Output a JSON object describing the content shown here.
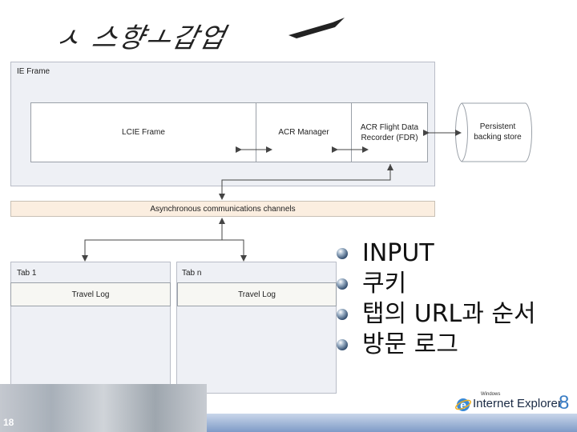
{
  "title": {
    "text": "ㅅ 스향ㅗ갑업"
  },
  "diagram": {
    "ie_frame": "IE Frame",
    "lcie_frame": "LCIE Frame",
    "acr_manager": "ACR Manager",
    "fdr_line1": "ACR Flight Data",
    "fdr_line2": "Recorder (FDR)",
    "persistent_line1": "Persistent",
    "persistent_line2": "backing store",
    "async_channels": "Asynchronous communications channels",
    "tab1": "Tab 1",
    "tabn": "Tab n",
    "travel_log_1": "Travel Log",
    "travel_log_n": "Travel Log"
  },
  "bullets": [
    "INPUT",
    "쿠키",
    "탭의 URL과 순서",
    "방문 로그"
  ],
  "footer": {
    "page_number": "18",
    "logo_small": "Windows",
    "logo_text": "Internet Explorer",
    "logo_version": "8"
  },
  "colors": {
    "frame_bg": "#eef0f5",
    "async_bg": "#fbeee0",
    "bar": "#7f9bc7"
  }
}
